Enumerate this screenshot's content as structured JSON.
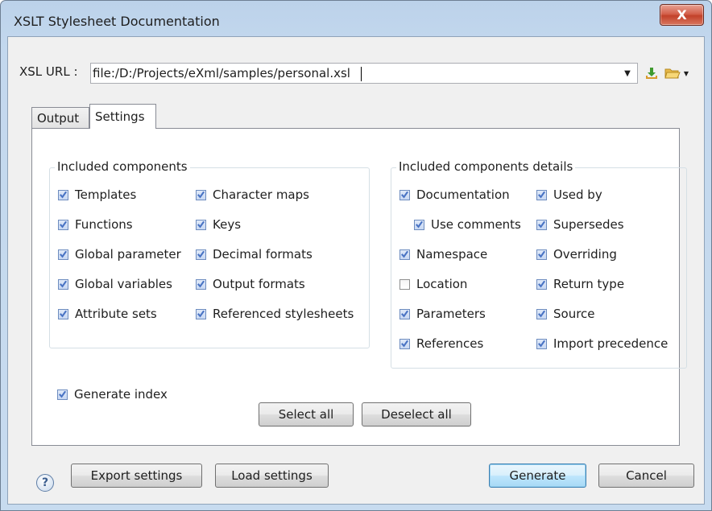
{
  "window": {
    "title": "XSLT Stylesheet Documentation",
    "close_glyph": "X"
  },
  "url_row": {
    "label": "XSL URL :",
    "value": "file:/D:/Projects/eXml/samples/personal.xsl",
    "dropdown_glyph": "▼",
    "icons": [
      "download-icon",
      "folder-open-icon",
      "chevron-down-icon"
    ]
  },
  "tabs": [
    {
      "label": "Output",
      "active": false
    },
    {
      "label": "Settings",
      "active": true
    }
  ],
  "included_components": {
    "title": "Included components",
    "items": [
      {
        "label": "Templates",
        "checked": true
      },
      {
        "label": "Functions",
        "checked": true
      },
      {
        "label": "Global parameter",
        "checked": true
      },
      {
        "label": "Global variables",
        "checked": true
      },
      {
        "label": "Attribute sets",
        "checked": true
      },
      {
        "label": "Character maps",
        "checked": true
      },
      {
        "label": "Keys",
        "checked": true
      },
      {
        "label": "Decimal formats",
        "checked": true
      },
      {
        "label": "Output formats",
        "checked": true
      },
      {
        "label": "Referenced stylesheets",
        "checked": true
      }
    ]
  },
  "generate_index": {
    "label": "Generate index",
    "checked": true
  },
  "included_details": {
    "title": "Included components details",
    "items": [
      {
        "label": "Documentation",
        "checked": true
      },
      {
        "label": "Use comments",
        "checked": true
      },
      {
        "label": "Namespace",
        "checked": true
      },
      {
        "label": "Location",
        "checked": false
      },
      {
        "label": "Parameters",
        "checked": true
      },
      {
        "label": "References",
        "checked": true
      },
      {
        "label": "Used by",
        "checked": true
      },
      {
        "label": "Supersedes",
        "checked": true
      },
      {
        "label": "Overriding",
        "checked": true
      },
      {
        "label": "Return type",
        "checked": true
      },
      {
        "label": "Source",
        "checked": true
      },
      {
        "label": "Import precedence",
        "checked": true
      }
    ]
  },
  "buttons": {
    "select_all": "Select all",
    "deselect_all": "Deselect all",
    "export_settings": "Export settings",
    "load_settings": "Load settings",
    "generate": "Generate",
    "cancel": "Cancel",
    "help_glyph": "?"
  },
  "colors": {
    "frame": "#c3d8ee",
    "checkbox_check": "#4a74c4",
    "default_button_border": "#3c7fb1"
  }
}
